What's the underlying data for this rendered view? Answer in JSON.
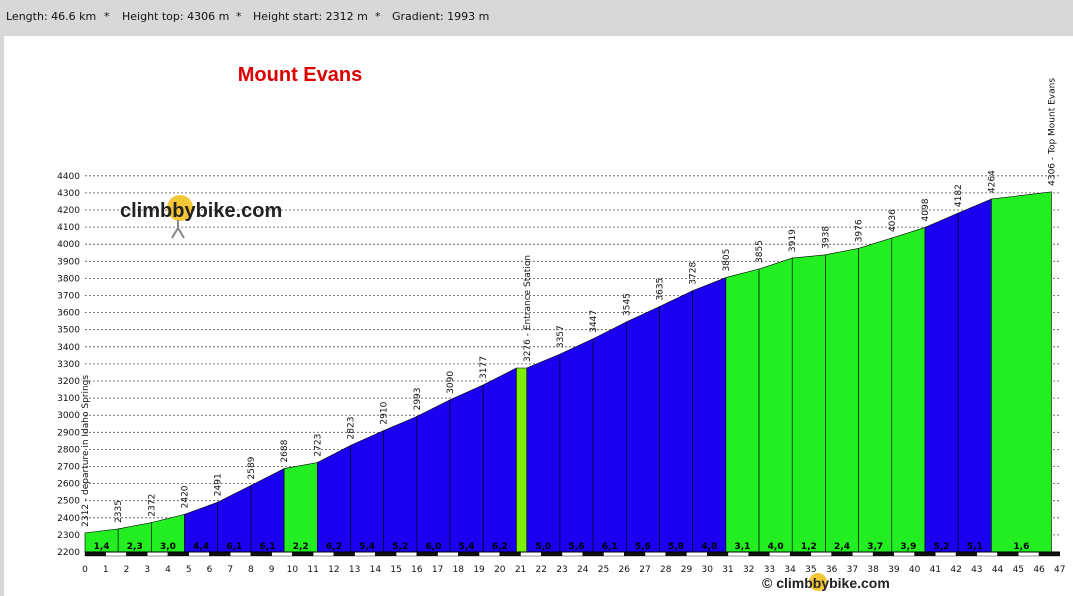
{
  "stats": {
    "length": "Length: 46.6 km",
    "height_top": "Height top: 4306 m",
    "height_start": "Height start: 2312 m",
    "gradient": "Gradient: 1993 m",
    "separator": "*"
  },
  "watermark": {
    "logo_text": "climbbybike.com",
    "copyright_text": "© climbbybike.com"
  },
  "colors": {
    "steep": "#1b00ef",
    "moderate": "#22ee22",
    "hilite": "#7cf000",
    "dark_track": "#111111",
    "title": "#dd0000"
  },
  "chart_data": {
    "type": "area",
    "title": "Mount Evans",
    "xlim": [
      0,
      47
    ],
    "ylim": [
      2200,
      4400
    ],
    "x_ticks": [
      0,
      1,
      2,
      3,
      4,
      5,
      6,
      7,
      8,
      9,
      10,
      11,
      12,
      13,
      14,
      15,
      16,
      17,
      18,
      19,
      20,
      21,
      22,
      23,
      24,
      25,
      26,
      27,
      28,
      29,
      30,
      31,
      32,
      33,
      34,
      35,
      36,
      37,
      38,
      39,
      40,
      41,
      42,
      43,
      44,
      45,
      46,
      47
    ],
    "y_ticks": [
      2200,
      2300,
      2400,
      2500,
      2600,
      2700,
      2800,
      2900,
      3000,
      3100,
      3200,
      3300,
      3400,
      3500,
      3600,
      3700,
      3800,
      3900,
      4000,
      4100,
      4200,
      4300,
      4400
    ],
    "grid": "horizontal dashed",
    "profile": [
      [
        0.0,
        2312
      ],
      [
        1.6,
        2335
      ],
      [
        3.2,
        2372
      ],
      [
        4.8,
        2420
      ],
      [
        6.4,
        2491
      ],
      [
        8.0,
        2589
      ],
      [
        9.6,
        2688
      ],
      [
        11.2,
        2723
      ],
      [
        12.8,
        2823
      ],
      [
        14.4,
        2910
      ],
      [
        16.0,
        2993
      ],
      [
        17.6,
        3090
      ],
      [
        19.2,
        3177
      ],
      [
        20.8,
        3276
      ],
      [
        21.3,
        3276
      ],
      [
        22.9,
        3357
      ],
      [
        24.5,
        3447
      ],
      [
        26.1,
        3545
      ],
      [
        27.7,
        3635
      ],
      [
        29.3,
        3728
      ],
      [
        30.9,
        3805
      ],
      [
        32.5,
        3855
      ],
      [
        34.1,
        3919
      ],
      [
        35.7,
        3938
      ],
      [
        37.3,
        3976
      ],
      [
        38.9,
        4036
      ],
      [
        40.5,
        4098
      ],
      [
        42.1,
        4182
      ],
      [
        43.7,
        4264
      ],
      [
        46.6,
        4306
      ]
    ],
    "segments": [
      {
        "x0": 0.0,
        "x1": 1.6,
        "color": "moderate",
        "gradient": "1,4"
      },
      {
        "x0": 1.6,
        "x1": 3.2,
        "color": "moderate",
        "gradient": "2,3"
      },
      {
        "x0": 3.2,
        "x1": 4.8,
        "color": "moderate",
        "gradient": "3,0"
      },
      {
        "x0": 4.8,
        "x1": 6.4,
        "color": "steep",
        "gradient": "4,4"
      },
      {
        "x0": 6.4,
        "x1": 8.0,
        "color": "steep",
        "gradient": "6,1"
      },
      {
        "x0": 8.0,
        "x1": 9.6,
        "color": "steep",
        "gradient": "6,1"
      },
      {
        "x0": 9.6,
        "x1": 11.2,
        "color": "moderate",
        "gradient": "2,2"
      },
      {
        "x0": 11.2,
        "x1": 12.8,
        "color": "steep",
        "gradient": "6,2"
      },
      {
        "x0": 12.8,
        "x1": 14.4,
        "color": "steep",
        "gradient": "5,4"
      },
      {
        "x0": 14.4,
        "x1": 16.0,
        "color": "steep",
        "gradient": "5,2"
      },
      {
        "x0": 16.0,
        "x1": 17.6,
        "color": "steep",
        "gradient": "6,0"
      },
      {
        "x0": 17.6,
        "x1": 19.2,
        "color": "steep",
        "gradient": "5,4"
      },
      {
        "x0": 19.2,
        "x1": 20.8,
        "color": "steep",
        "gradient": "6,2"
      },
      {
        "x0": 20.8,
        "x1": 21.3,
        "color": "moderate",
        "gradient": ""
      },
      {
        "x0": 21.3,
        "x1": 22.9,
        "color": "steep",
        "gradient": "5,0"
      },
      {
        "x0": 22.9,
        "x1": 24.5,
        "color": "steep",
        "gradient": "5,6"
      },
      {
        "x0": 24.5,
        "x1": 26.1,
        "color": "steep",
        "gradient": "6,1"
      },
      {
        "x0": 26.1,
        "x1": 27.7,
        "color": "steep",
        "gradient": "5,6"
      },
      {
        "x0": 27.7,
        "x1": 29.3,
        "color": "steep",
        "gradient": "5,8"
      },
      {
        "x0": 29.3,
        "x1": 30.9,
        "color": "steep",
        "gradient": "4,8"
      },
      {
        "x0": 30.9,
        "x1": 32.5,
        "color": "moderate",
        "gradient": "3,1"
      },
      {
        "x0": 32.5,
        "x1": 34.1,
        "color": "moderate",
        "gradient": "4,0"
      },
      {
        "x0": 34.1,
        "x1": 35.7,
        "color": "moderate",
        "gradient": "1,2"
      },
      {
        "x0": 35.7,
        "x1": 37.3,
        "color": "moderate",
        "gradient": "2,4"
      },
      {
        "x0": 37.3,
        "x1": 38.9,
        "color": "moderate",
        "gradient": "3,7"
      },
      {
        "x0": 38.9,
        "x1": 40.5,
        "color": "moderate",
        "gradient": "3,9"
      },
      {
        "x0": 40.5,
        "x1": 42.1,
        "color": "steep",
        "gradient": "5,2"
      },
      {
        "x0": 42.1,
        "x1": 43.7,
        "color": "steep",
        "gradient": "5,1"
      },
      {
        "x0": 43.7,
        "x1": 46.6,
        "color": "moderate",
        "gradient": "1,6"
      }
    ],
    "height_labels": [
      {
        "x": 0.0,
        "text": "2312 - departure in Idaho Springs"
      },
      {
        "x": 1.6,
        "text": "2335"
      },
      {
        "x": 3.2,
        "text": "2372"
      },
      {
        "x": 4.8,
        "text": "2420"
      },
      {
        "x": 6.4,
        "text": "2491"
      },
      {
        "x": 8.0,
        "text": "2589"
      },
      {
        "x": 9.6,
        "text": "2688"
      },
      {
        "x": 11.2,
        "text": "2723"
      },
      {
        "x": 12.8,
        "text": "2823"
      },
      {
        "x": 14.4,
        "text": "2910"
      },
      {
        "x": 16.0,
        "text": "2993"
      },
      {
        "x": 17.6,
        "text": "3090"
      },
      {
        "x": 19.2,
        "text": "3177"
      },
      {
        "x": 21.3,
        "text": "3276 - Entrance Station"
      },
      {
        "x": 22.9,
        "text": "3357"
      },
      {
        "x": 24.5,
        "text": "3447"
      },
      {
        "x": 26.1,
        "text": "3545"
      },
      {
        "x": 27.7,
        "text": "3635"
      },
      {
        "x": 29.3,
        "text": "3728"
      },
      {
        "x": 30.9,
        "text": "3805"
      },
      {
        "x": 32.5,
        "text": "3855"
      },
      {
        "x": 34.1,
        "text": "3919"
      },
      {
        "x": 35.7,
        "text": "3938"
      },
      {
        "x": 37.3,
        "text": "3976"
      },
      {
        "x": 38.9,
        "text": "4036"
      },
      {
        "x": 40.5,
        "text": "4098"
      },
      {
        "x": 42.1,
        "text": "4182"
      },
      {
        "x": 43.7,
        "text": "4264"
      },
      {
        "x": 46.6,
        "text": "4306 - Top Mount Evans"
      }
    ]
  }
}
